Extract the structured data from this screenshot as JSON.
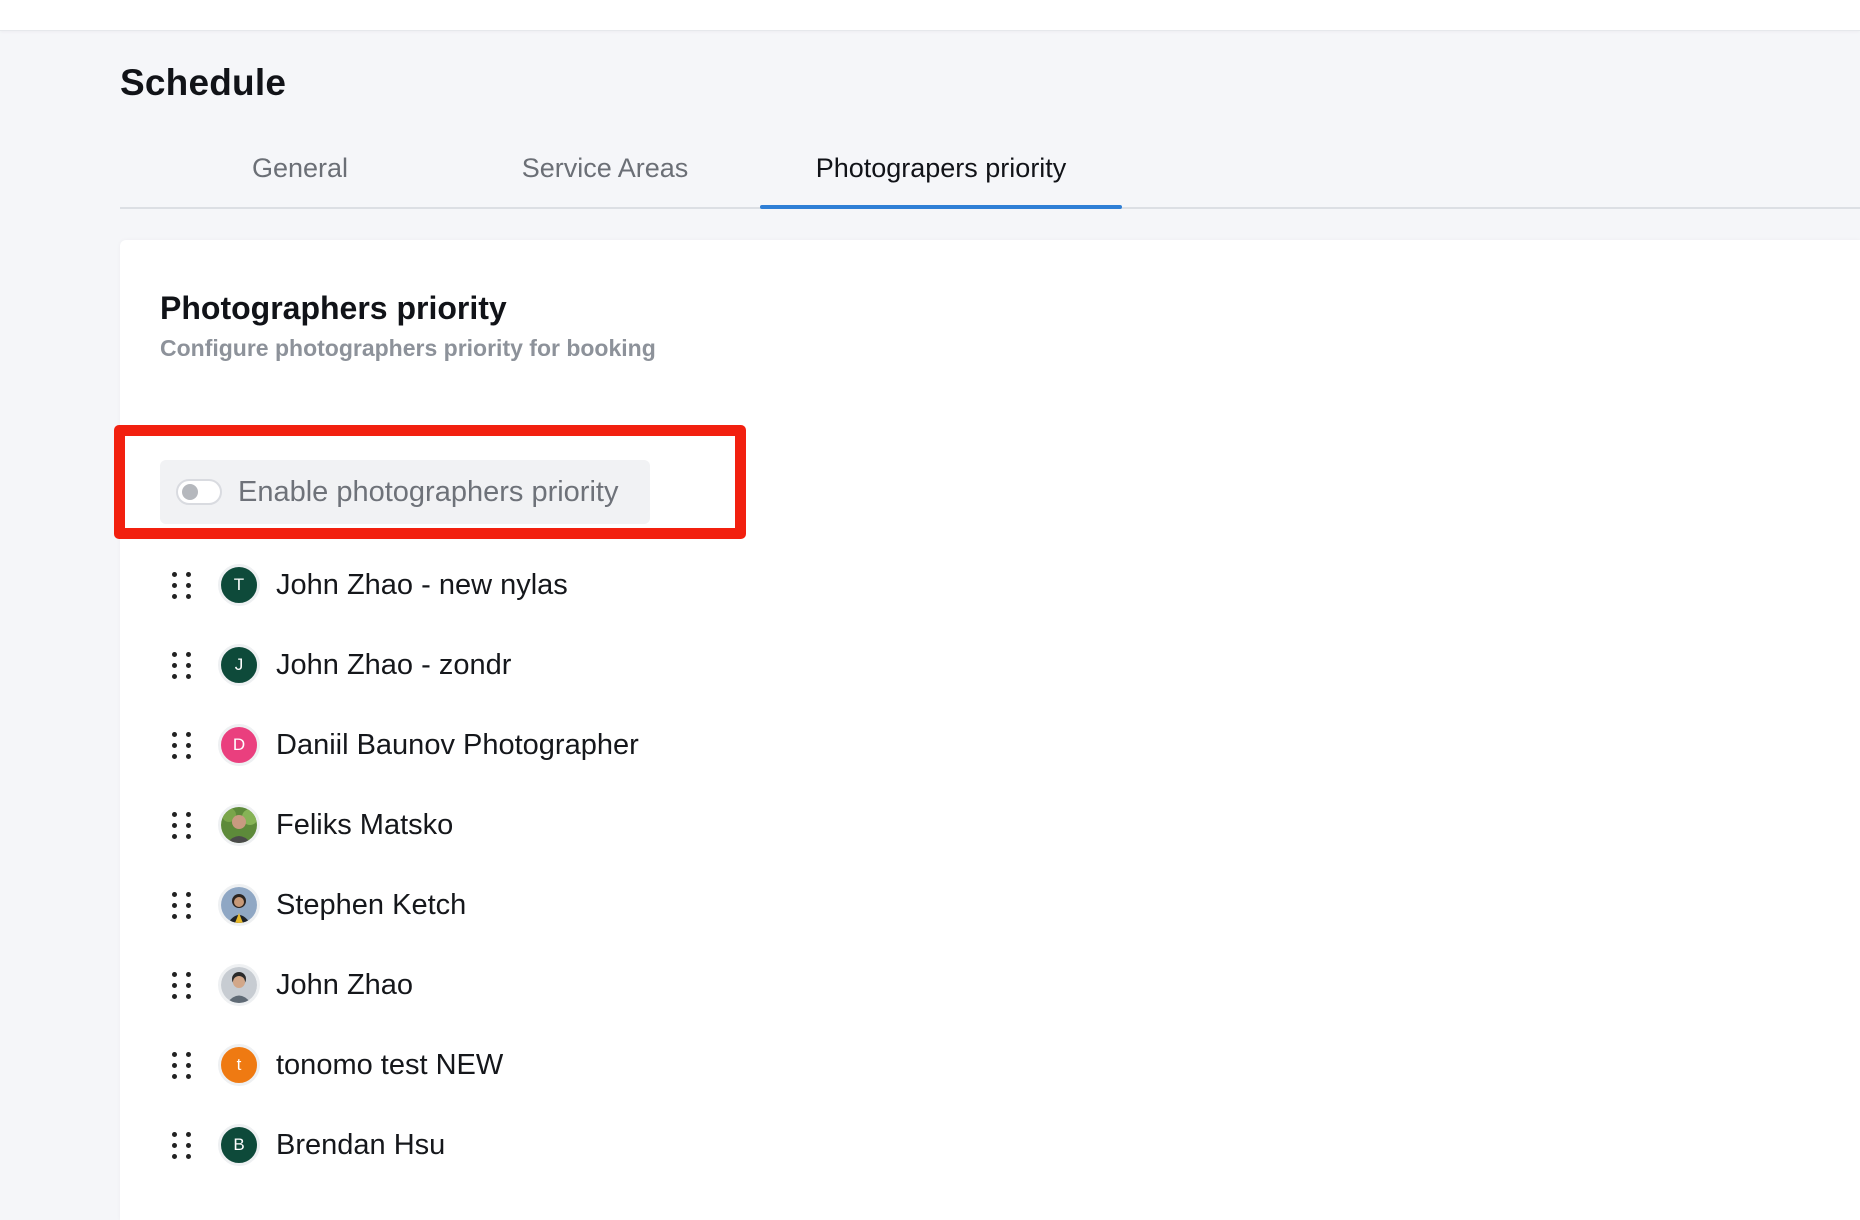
{
  "page": {
    "title": "Schedule"
  },
  "tabs": [
    {
      "label": "General",
      "active": false
    },
    {
      "label": "Service Areas",
      "active": false
    },
    {
      "label": "Photograpers priority",
      "active": true
    }
  ],
  "section": {
    "title": "Photographers priority",
    "subtitle": "Configure photographers priority for booking"
  },
  "toggle": {
    "label": "Enable photographers priority",
    "enabled": false
  },
  "photographers": [
    {
      "name": "John Zhao - new nylas",
      "initial": "T",
      "avatar_color": "#0e4a3a",
      "avatar": "initial"
    },
    {
      "name": "John Zhao - zondr",
      "initial": "J",
      "avatar_color": "#0e4a3a",
      "avatar": "initial"
    },
    {
      "name": "Daniil Baunov Photographer",
      "initial": "D",
      "avatar_color": "#ea3f7e",
      "avatar": "initial"
    },
    {
      "name": "Feliks Matsko",
      "avatar": "photo"
    },
    {
      "name": "Stephen Ketch",
      "avatar": "photo"
    },
    {
      "name": "John Zhao",
      "avatar": "photo"
    },
    {
      "name": "tonomo test NEW",
      "initial": "t",
      "avatar_color": "#ef7a12",
      "avatar": "initial"
    },
    {
      "name": "Brendan Hsu",
      "initial": "B",
      "avatar_color": "#0e4a3a",
      "avatar": "initial"
    }
  ],
  "colors": {
    "accent": "#2f7fd6",
    "highlight": "#f2200f"
  }
}
